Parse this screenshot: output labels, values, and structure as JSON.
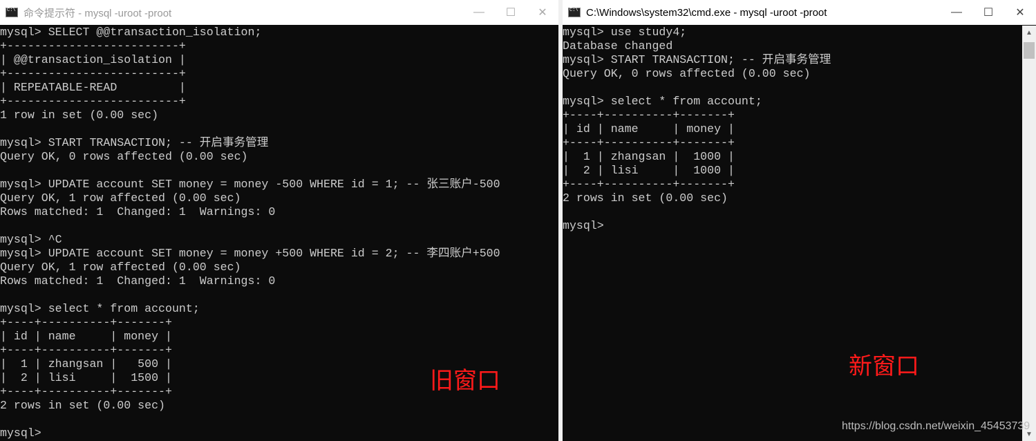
{
  "left_window": {
    "title": "命令提示符 - mysql  -uroot -proot",
    "controls": {
      "minimize": "—",
      "maximize": "☐",
      "close": "✕"
    },
    "lines": [
      "mysql> SELECT @@transaction_isolation;",
      "+-------------------------+",
      "| @@transaction_isolation |",
      "+-------------------------+",
      "| REPEATABLE-READ         |",
      "+-------------------------+",
      "1 row in set (0.00 sec)",
      "",
      "mysql> START TRANSACTION; -- 开启事务管理",
      "Query OK, 0 rows affected (0.00 sec)",
      "",
      "mysql> UPDATE account SET money = money -500 WHERE id = 1; -- 张三账户-500",
      "Query OK, 1 row affected (0.00 sec)",
      "Rows matched: 1  Changed: 1  Warnings: 0",
      "",
      "mysql> ^C",
      "mysql> UPDATE account SET money = money +500 WHERE id = 2; -- 李四账户+500",
      "Query OK, 1 row affected (0.00 sec)",
      "Rows matched: 1  Changed: 1  Warnings: 0",
      "",
      "mysql> select * from account;",
      "+----+----------+-------+",
      "| id | name     | money |",
      "+----+----------+-------+",
      "|  1 | zhangsan |   500 |",
      "|  2 | lisi     |  1500 |",
      "+----+----------+-------+",
      "2 rows in set (0.00 sec)",
      "",
      "mysql>"
    ],
    "annotation": "旧窗口"
  },
  "right_window": {
    "title": "C:\\Windows\\system32\\cmd.exe - mysql  -uroot -proot",
    "controls": {
      "minimize": "—",
      "maximize": "☐",
      "close": "✕"
    },
    "lines": [
      "mysql> use study4;",
      "Database changed",
      "mysql> START TRANSACTION; -- 开启事务管理",
      "Query OK, 0 rows affected (0.00 sec)",
      "",
      "mysql> select * from account;",
      "+----+----------+-------+",
      "| id | name     | money |",
      "+----+----------+-------+",
      "|  1 | zhangsan |  1000 |",
      "|  2 | lisi     |  1000 |",
      "+----+----------+-------+",
      "2 rows in set (0.00 sec)",
      "",
      "mysql>"
    ],
    "annotation": "新窗口"
  },
  "watermark": "https://blog.csdn.net/weixin_45453739",
  "colors": {
    "terminal_bg": "#0c0c0c",
    "terminal_fg": "#cccccc",
    "annotation": "#ff1a1a"
  }
}
